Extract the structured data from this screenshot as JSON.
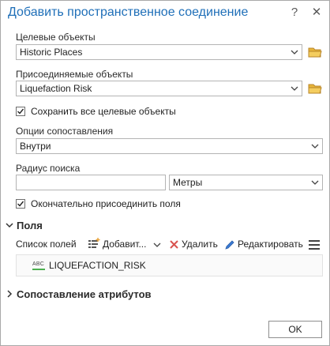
{
  "dialog": {
    "title": "Добавить пространственное соединение",
    "help_glyph": "?",
    "close_glyph": "✕"
  },
  "target": {
    "label": "Целевые объекты",
    "value": "Historic Places"
  },
  "join": {
    "label": "Присоединяемые объекты",
    "value": "Liquefaction Risk"
  },
  "keep_all": {
    "label": "Сохранить все целевые объекты",
    "checked": true
  },
  "match": {
    "label": "Опции сопоставления",
    "value": "Внутри"
  },
  "search_radius": {
    "label": "Радиус поиска",
    "value": "",
    "unit": "Метры"
  },
  "permanent": {
    "label": "Окончательно присоединить поля",
    "checked": true
  },
  "fields_section": {
    "title": "Поля",
    "list_label": "Список полей",
    "add_label": "Добавит...",
    "remove_label": "Удалить",
    "edit_label": "Редактировать",
    "items": [
      {
        "type": "ABC",
        "name": "LIQUEFACTION_RISK"
      }
    ]
  },
  "attribute_matching": {
    "title": "Сопоставление атрибутов"
  },
  "footer": {
    "ok_label": "OK"
  },
  "colors": {
    "title": "#1f6fb8",
    "folder": "#e8b53a",
    "remove_x": "#d9534f",
    "text_field_underline": "#4caf50"
  }
}
